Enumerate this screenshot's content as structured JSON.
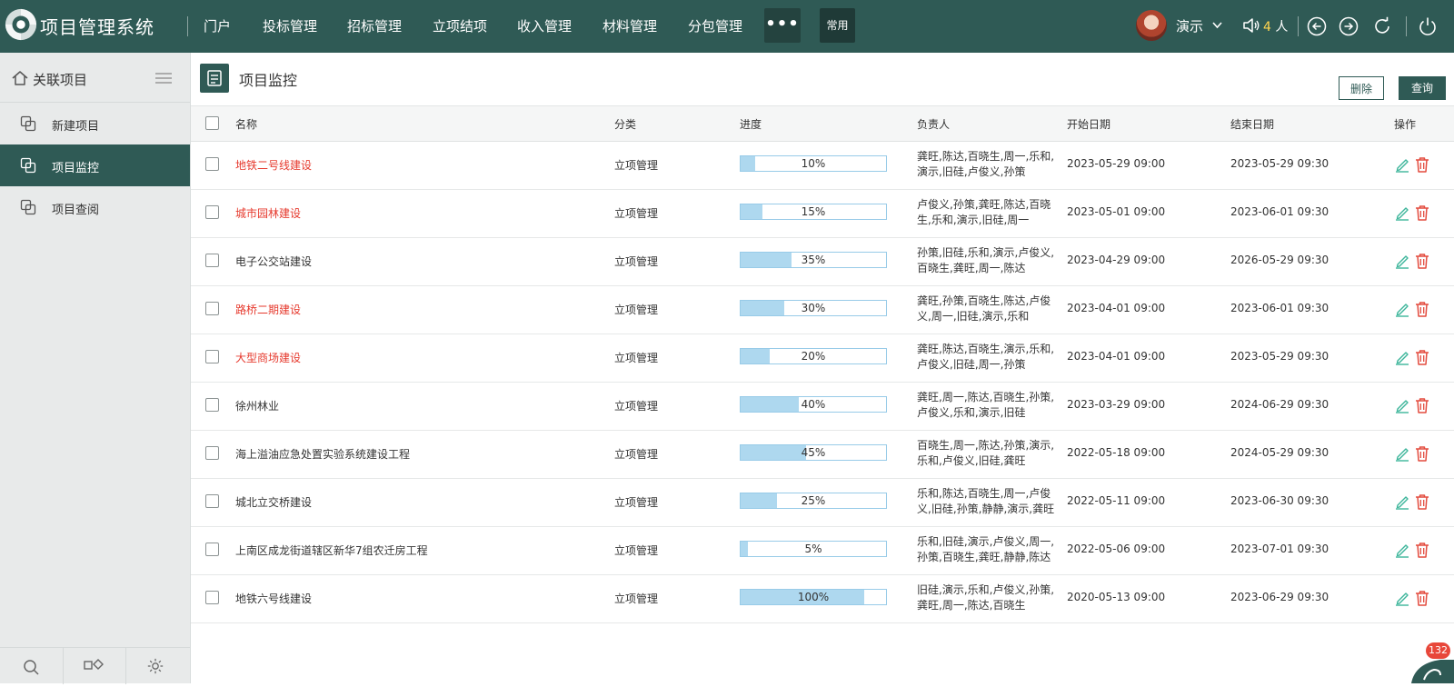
{
  "app": {
    "title": "项目管理系统"
  },
  "nav": {
    "items": [
      "门户",
      "投标管理",
      "招标管理",
      "立项结项",
      "收入管理",
      "材料管理",
      "分包管理"
    ],
    "more": "•••",
    "common": "常用"
  },
  "user": {
    "name": "演示",
    "online_count": "4",
    "online_unit": "人"
  },
  "sidebar": {
    "header": "关联项目",
    "items": [
      {
        "label": "新建项目",
        "active": false
      },
      {
        "label": "项目监控",
        "active": true
      },
      {
        "label": "项目查阅",
        "active": false
      }
    ]
  },
  "page": {
    "title": "项目监控",
    "delete_label": "删除",
    "query_label": "查询"
  },
  "table": {
    "headers": [
      "名称",
      "分类",
      "进度",
      "负责人",
      "开始日期",
      "结束日期",
      "操作"
    ],
    "rows": [
      {
        "name": "地铁二号线建设",
        "highlight": true,
        "category": "立项管理",
        "progress": 10,
        "progress_label": "10%",
        "owners": "龚旺,陈达,百晓生,周一,乐和,演示,旧硅,卢俊义,孙策",
        "start": "2023-05-29 09:00",
        "end": "2023-05-29 09:30"
      },
      {
        "name": "城市园林建设",
        "highlight": true,
        "category": "立项管理",
        "progress": 15,
        "progress_label": "15%",
        "owners": "卢俊义,孙策,龚旺,陈达,百晓生,乐和,演示,旧硅,周一",
        "start": "2023-05-01 09:00",
        "end": "2023-06-01 09:30"
      },
      {
        "name": "电子公交站建设",
        "highlight": false,
        "category": "立项管理",
        "progress": 35,
        "progress_label": "35%",
        "owners": "孙策,旧硅,乐和,演示,卢俊义,百晓生,龚旺,周一,陈达",
        "start": "2023-04-29 09:00",
        "end": "2026-05-29 09:30"
      },
      {
        "name": "路桥二期建设",
        "highlight": true,
        "category": "立项管理",
        "progress": 30,
        "progress_label": "30%",
        "owners": "龚旺,孙策,百晓生,陈达,卢俊义,周一,旧硅,演示,乐和",
        "start": "2023-04-01 09:00",
        "end": "2023-06-01 09:30"
      },
      {
        "name": "大型商场建设",
        "highlight": true,
        "category": "立项管理",
        "progress": 20,
        "progress_label": "20%",
        "owners": "龚旺,陈达,百晓生,演示,乐和,卢俊义,旧硅,周一,孙策",
        "start": "2023-04-01 09:00",
        "end": "2023-05-29 09:30"
      },
      {
        "name": "徐州林业",
        "highlight": false,
        "category": "立项管理",
        "progress": 40,
        "progress_label": "40%",
        "owners": "龚旺,周一,陈达,百晓生,孙策,卢俊义,乐和,演示,旧硅",
        "start": "2023-03-29 09:00",
        "end": "2024-06-29 09:30"
      },
      {
        "name": "海上溢油应急处置实验系统建设工程",
        "highlight": false,
        "category": "立项管理",
        "progress": 45,
        "progress_label": "45%",
        "owners": "百晓生,周一,陈达,孙策,演示,乐和,卢俊义,旧硅,龚旺",
        "start": "2022-05-18 09:00",
        "end": "2024-05-29 09:30"
      },
      {
        "name": "城北立交桥建设",
        "highlight": false,
        "category": "立项管理",
        "progress": 25,
        "progress_label": "25%",
        "owners": "乐和,陈达,百晓生,周一,卢俊义,旧硅,孙策,静静,演示,龚旺",
        "start": "2022-05-11 09:00",
        "end": "2023-06-30 09:30"
      },
      {
        "name": "上南区成龙街道辖区新华7组农迁房工程",
        "highlight": false,
        "category": "立项管理",
        "progress": 5,
        "progress_label": "5%",
        "owners": "乐和,旧硅,演示,卢俊义,周一,孙策,百晓生,龚旺,静静,陈达",
        "start": "2022-05-06 09:00",
        "end": "2023-07-01 09:30"
      },
      {
        "name": "地铁六号线建设",
        "highlight": false,
        "category": "立项管理",
        "progress": 85,
        "progress_label": "100%",
        "owners": "旧硅,演示,乐和,卢俊义,孙策,龚旺,周一,陈达,百晓生",
        "start": "2020-05-13 09:00",
        "end": "2023-06-29 09:30"
      }
    ]
  },
  "notification": {
    "count": "132"
  },
  "colors": {
    "primary": "#2f5a55",
    "highlight_text": "#e63a2e",
    "progress_fill": "#aed8ef"
  }
}
